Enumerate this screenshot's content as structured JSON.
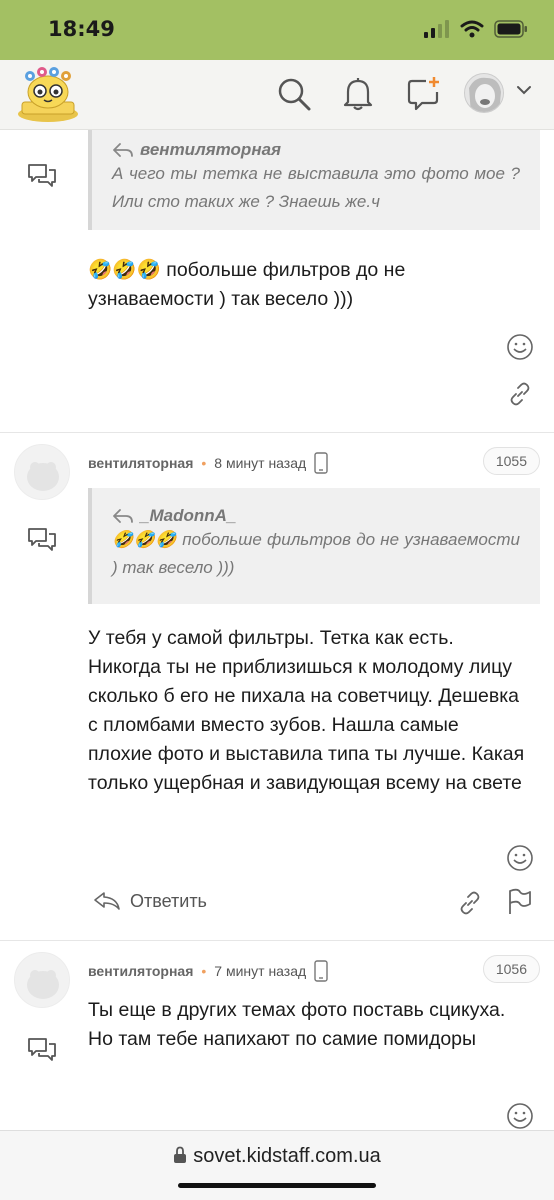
{
  "status_bar": {
    "time": "18:49"
  },
  "header": {
    "icons": [
      "search-icon",
      "bell-icon",
      "new-message-icon"
    ],
    "avatar": "user-avatar"
  },
  "comments": [
    {
      "quote": {
        "author": "вентиляторная",
        "text": "А чего ты тетка не выставила это фото мое ? Или сто таких же ? Знаешь же.ч"
      },
      "emojis": "🤣🤣🤣",
      "text": " побольше фильтров до не узнаваемости ) так весело )))"
    },
    {
      "author": "вентиляторная",
      "time": "8 минут назад",
      "number": "1055",
      "quote": {
        "author": "_MadonnA_",
        "emojis": "🤣🤣🤣",
        "text": "побольше фильтров до не узнаваемости ) так весело )))"
      },
      "text": "У тебя у самой фильтры. Тетка как есть. Никогда ты не приблизишься к молодому лицу сколько б его не пихала на советчицу. Дешевка с пломбами вместо зубов. Нашла самые плохие фото и выставила типа ты лучше. Какая только ущербная и завидующая всему на свете",
      "reply_label": "Ответить"
    },
    {
      "author": "вентиляторная",
      "time": "7 минут назад",
      "number": "1056",
      "text": "Ты еще в других темах фото поставь сцикуха. Но там тебе напихают по самие помидоры"
    }
  ],
  "url_bar": {
    "url": "sovet.kidstaff.com.ua"
  },
  "colors": {
    "status_bar": "#a3c063",
    "accent_dot": "#f0a060"
  }
}
